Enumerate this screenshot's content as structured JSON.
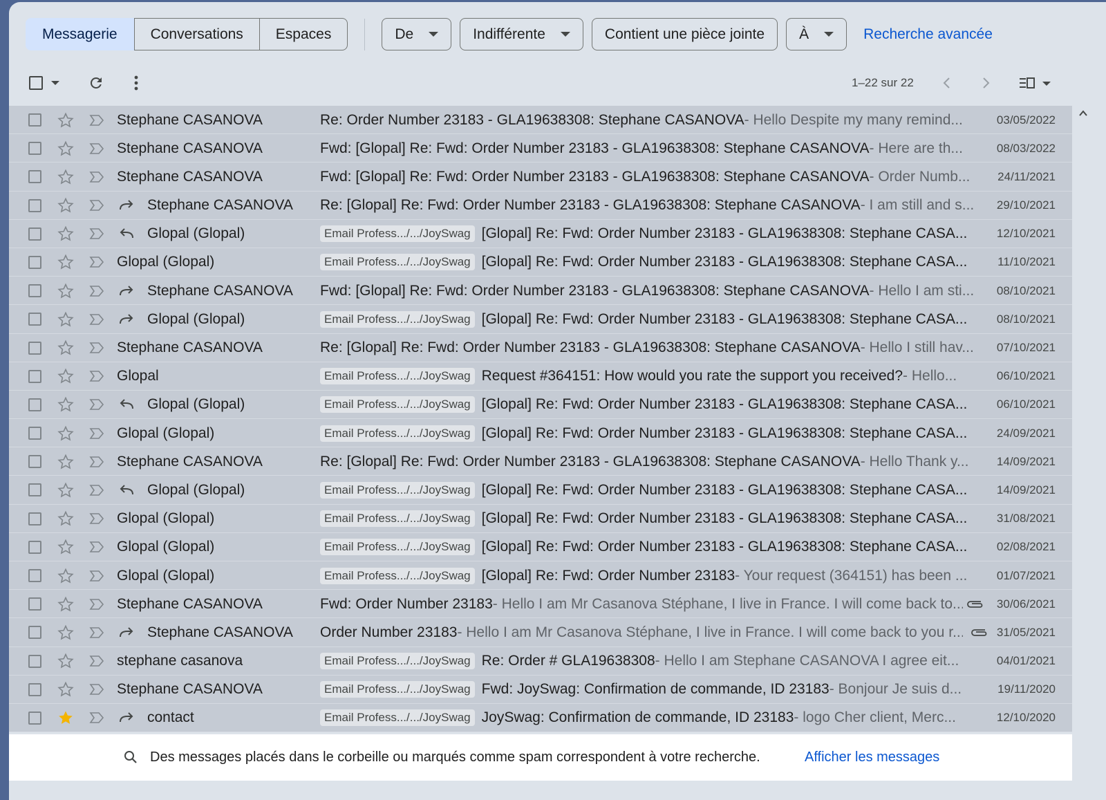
{
  "filters": {
    "scopes": [
      "Messagerie",
      "Conversations",
      "Espaces"
    ],
    "from_label": "De",
    "date_label": "Indifférente",
    "attachment_label": "Contient une pièce jointe",
    "to_label": "À",
    "advanced_label": "Recherche avancée"
  },
  "toolbar": {
    "range": "1–22 sur 22"
  },
  "emails": [
    {
      "sender": "Stephane CASANOVA",
      "action": "",
      "label": "",
      "subject": "Re: Order Number 23183 - GLA19638308: Stephane CASANOVA",
      "snippet": " - Hello Despite my many remind...",
      "date": "03/05/2022",
      "attachment": false,
      "starred": false
    },
    {
      "sender": "Stephane CASANOVA",
      "action": "",
      "label": "",
      "subject": "Fwd: [Glopal] Re: Fwd: Order Number 23183 - GLA19638308: Stephane CASANOVA",
      "snippet": " - Here are th...",
      "date": "08/03/2022",
      "attachment": false,
      "starred": false
    },
    {
      "sender": "Stephane CASANOVA",
      "action": "",
      "label": "",
      "subject": "Fwd: [Glopal] Re: Fwd: Order Number 23183 - GLA19638308: Stephane CASANOVA",
      "snippet": " - Order Numb...",
      "date": "24/11/2021",
      "attachment": false,
      "starred": false
    },
    {
      "sender": "Stephane CASANOVA",
      "action": "forward",
      "label": "",
      "subject": "Re: [Glopal] Re: Fwd: Order Number 23183 - GLA19638308: Stephane CASANOVA",
      "snippet": " - I am still and s...",
      "date": "29/10/2021",
      "attachment": false,
      "starred": false
    },
    {
      "sender": "Glopal (Glopal)",
      "action": "reply",
      "label": "Email Profess.../.../JoySwag",
      "subject": "[Glopal] Re: Fwd: Order Number 23183 - GLA19638308: Stephane CASA...",
      "snippet": "",
      "date": "12/10/2021",
      "attachment": false,
      "starred": false
    },
    {
      "sender": "Glopal (Glopal)",
      "action": "",
      "label": "Email Profess.../.../JoySwag",
      "subject": "[Glopal] Re: Fwd: Order Number 23183 - GLA19638308: Stephane CASA...",
      "snippet": "",
      "date": "11/10/2021",
      "attachment": false,
      "starred": false
    },
    {
      "sender": "Stephane CASANOVA",
      "action": "forward",
      "label": "",
      "subject": "Fwd: [Glopal] Re: Fwd: Order Number 23183 - GLA19638308: Stephane CASANOVA",
      "snippet": " - Hello I am sti...",
      "date": "08/10/2021",
      "attachment": false,
      "starred": false
    },
    {
      "sender": "Glopal (Glopal)",
      "action": "forward",
      "label": "Email Profess.../.../JoySwag",
      "subject": "[Glopal] Re: Fwd: Order Number 23183 - GLA19638308: Stephane CASA...",
      "snippet": "",
      "date": "08/10/2021",
      "attachment": false,
      "starred": false
    },
    {
      "sender": "Stephane CASANOVA",
      "action": "",
      "label": "",
      "subject": "Re: [Glopal] Re: Fwd: Order Number 23183 - GLA19638308: Stephane CASANOVA",
      "snippet": " - Hello I still hav...",
      "date": "07/10/2021",
      "attachment": false,
      "starred": false
    },
    {
      "sender": "Glopal",
      "action": "",
      "label": "Email Profess.../.../JoySwag",
      "subject": "Request #364151: How would you rate the support you received?",
      "snippet": " - Hello...",
      "date": "06/10/2021",
      "attachment": false,
      "starred": false
    },
    {
      "sender": "Glopal (Glopal)",
      "action": "reply",
      "label": "Email Profess.../.../JoySwag",
      "subject": "[Glopal] Re: Fwd: Order Number 23183 - GLA19638308: Stephane CASA...",
      "snippet": "",
      "date": "06/10/2021",
      "attachment": false,
      "starred": false
    },
    {
      "sender": "Glopal (Glopal)",
      "action": "",
      "label": "Email Profess.../.../JoySwag",
      "subject": "[Glopal] Re: Fwd: Order Number 23183 - GLA19638308: Stephane CASA...",
      "snippet": "",
      "date": "24/09/2021",
      "attachment": false,
      "starred": false
    },
    {
      "sender": "Stephane CASANOVA",
      "action": "",
      "label": "",
      "subject": "Re: [Glopal] Re: Fwd: Order Number 23183 - GLA19638308: Stephane CASANOVA",
      "snippet": " - Hello Thank y...",
      "date": "14/09/2021",
      "attachment": false,
      "starred": false
    },
    {
      "sender": "Glopal (Glopal)",
      "action": "reply",
      "label": "Email Profess.../.../JoySwag",
      "subject": "[Glopal] Re: Fwd: Order Number 23183 - GLA19638308: Stephane CASA...",
      "snippet": "",
      "date": "14/09/2021",
      "attachment": false,
      "starred": false
    },
    {
      "sender": "Glopal (Glopal)",
      "action": "",
      "label": "Email Profess.../.../JoySwag",
      "subject": "[Glopal] Re: Fwd: Order Number 23183 - GLA19638308: Stephane CASA...",
      "snippet": "",
      "date": "31/08/2021",
      "attachment": false,
      "starred": false
    },
    {
      "sender": "Glopal (Glopal)",
      "action": "",
      "label": "Email Profess.../.../JoySwag",
      "subject": "[Glopal] Re: Fwd: Order Number 23183 - GLA19638308: Stephane CASA...",
      "snippet": "",
      "date": "02/08/2021",
      "attachment": false,
      "starred": false
    },
    {
      "sender": "Glopal (Glopal)",
      "action": "",
      "label": "Email Profess.../.../JoySwag",
      "subject": "[Glopal] Re: Fwd: Order Number 23183",
      "snippet": " - Your request (364151) has been ...",
      "date": "01/07/2021",
      "attachment": false,
      "starred": false
    },
    {
      "sender": "Stephane CASANOVA",
      "action": "",
      "label": "",
      "subject": "Fwd: Order Number 23183",
      "snippet": " - Hello I am Mr Casanova Stéphane, I live in France. I will come back to...",
      "date": "30/06/2021",
      "attachment": true,
      "starred": false
    },
    {
      "sender": "Stephane CASANOVA",
      "action": "forward",
      "label": "",
      "subject": "Order Number 23183",
      "snippet": " - Hello I am Mr Casanova Stéphane, I live in France. I will come back to you r...",
      "date": "31/05/2021",
      "attachment": true,
      "starred": false
    },
    {
      "sender": "stephane casanova",
      "action": "",
      "label": "Email Profess.../.../JoySwag",
      "subject": "Re: Order # GLA19638308",
      "snippet": " - Hello I am Stephane CASANOVA I agree eit...",
      "date": "04/01/2021",
      "attachment": false,
      "starred": false
    },
    {
      "sender": "Stephane CASANOVA",
      "action": "",
      "label": "Email Profess.../.../JoySwag",
      "subject": "Fwd: JoySwag: Confirmation de commande, ID 23183",
      "snippet": " - Bonjour Je suis d...",
      "date": "19/11/2020",
      "attachment": false,
      "starred": false
    },
    {
      "sender": "contact",
      "action": "forward",
      "label": "Email Profess.../.../JoySwag",
      "subject": "JoySwag: Confirmation de commande, ID 23183",
      "snippet": " - logo Cher client, Merc...",
      "date": "12/10/2020",
      "attachment": false,
      "starred": true
    }
  ],
  "footer": {
    "text": "Des messages placés dans le corbeille ou marqués comme spam correspondent à votre recherche.",
    "link": "Afficher les messages"
  },
  "colors": {
    "accent": "#0b57d0",
    "star": "#f4b400",
    "row_bg": "#c5cbd4"
  }
}
